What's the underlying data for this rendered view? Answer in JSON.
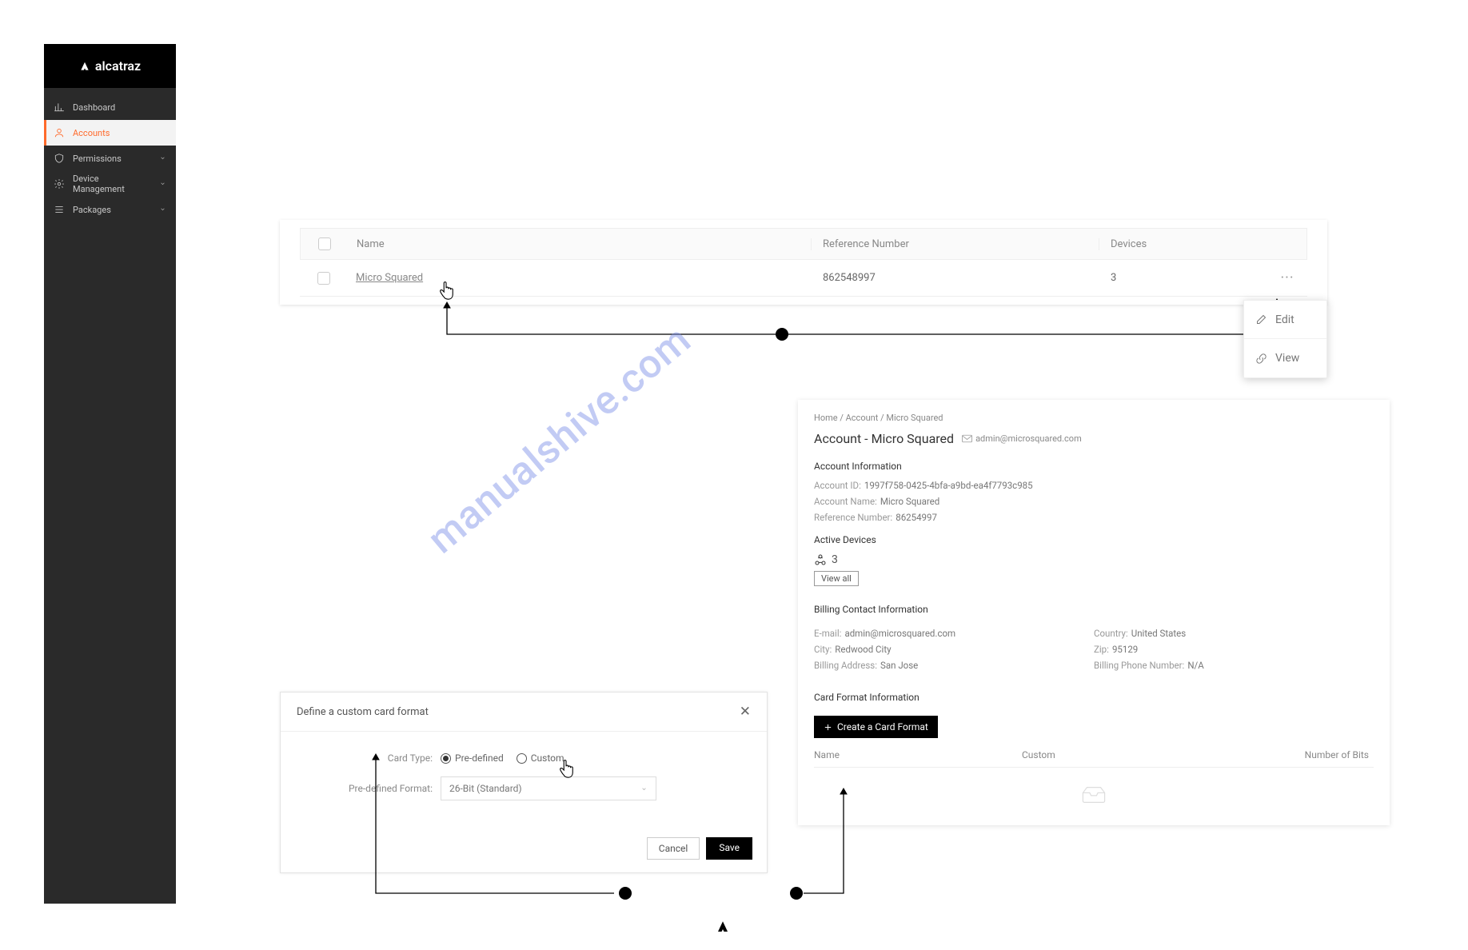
{
  "brand": {
    "name": "alcatraz"
  },
  "sidebar": {
    "items": [
      {
        "label": "Dashboard"
      },
      {
        "label": "Accounts"
      },
      {
        "label": "Permissions"
      },
      {
        "label": "Device Management"
      },
      {
        "label": "Packages"
      }
    ]
  },
  "table": {
    "headers": {
      "name": "Name",
      "reference": "Reference Number",
      "devices": "Devices"
    },
    "rows": [
      {
        "name": "Micro Squared",
        "reference": "862548997",
        "devices": "3"
      }
    ]
  },
  "action_menu": {
    "edit": "Edit",
    "view": "View"
  },
  "detail": {
    "breadcrumbs": {
      "home": "Home",
      "account": "Account",
      "current": "Micro Squared"
    },
    "title": "Account - Micro Squared",
    "email": "admin@microsquared.com",
    "sections": {
      "account_info": "Account Information",
      "active_devices": "Active Devices",
      "billing": "Billing Contact Information",
      "card_format": "Card Format Information"
    },
    "account": {
      "id_label": "Account ID:",
      "id": "1997f758-0425-4bfa-a9bd-ea4f7793c985",
      "name_label": "Account Name:",
      "name": "Micro Squared",
      "ref_label": "Reference Number:",
      "ref": "86254997"
    },
    "devices_count": "3",
    "view_all": "View all",
    "billing": {
      "email_label": "E-mail:",
      "email": "admin@microsquared.com",
      "city_label": "City:",
      "city": "Redwood City",
      "addr_label": "Billing Address:",
      "addr": "San Jose",
      "country_label": "Country:",
      "country": "United States",
      "zip_label": "Zip:",
      "zip": "95129",
      "phone_label": "Billing Phone Number:",
      "phone": "N/A"
    },
    "create_format": "Create a Card Format",
    "card_table": {
      "name": "Name",
      "custom": "Custom",
      "bits": "Number of Bits"
    }
  },
  "modal": {
    "title": "Define a custom card format",
    "card_type_label": "Card Type:",
    "option_predefined": "Pre-defined",
    "option_custom": "Custom",
    "format_label": "Pre-defined Format:",
    "format_value": "26-Bit (Standard)",
    "cancel": "Cancel",
    "save": "Save"
  },
  "watermark": "manualshive.com"
}
